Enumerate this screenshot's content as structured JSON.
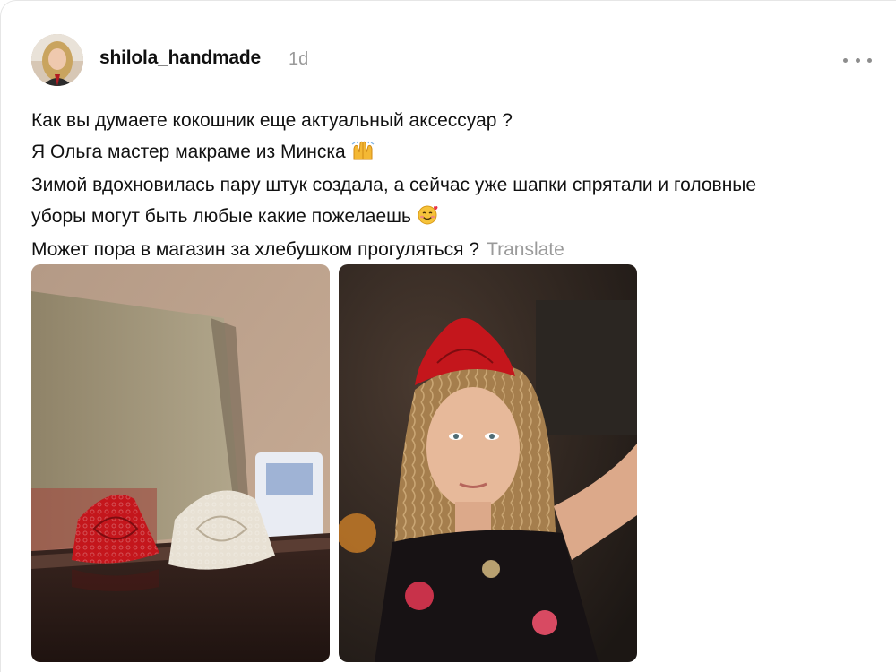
{
  "post": {
    "username": "shilola_handmade",
    "time": "1d",
    "more_icon": "more-horizontal-icon",
    "lines": [
      "Как вы думаете кокошник еще актуальный аксессуар ?",
      "Я Ольга мастер макраме из Минска",
      "Зимой вдохновилась пару штук создала, а сейчас уже шапки спрятали и головные",
      "уборы могут быть любые какие пожелаешь",
      "Может пора в магазин за хлебушком прогуляться ?"
    ],
    "translate_label": "Translate",
    "emojis": [
      "raising-hands-emoji",
      "smiling-face-with-hearts-emoji"
    ],
    "images": [
      {
        "name": "kokoshniks-on-shelf-photo",
        "subject": "red and white macrame kokoshniks"
      },
      {
        "name": "woman-wearing-red-kokoshnik-photo",
        "subject": "selfie with red macrame kokoshnik"
      }
    ]
  }
}
